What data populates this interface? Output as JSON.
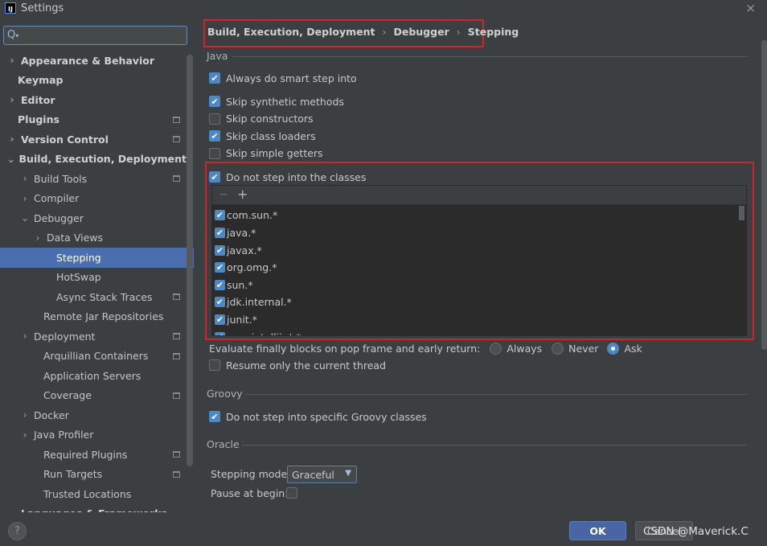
{
  "window": {
    "title": "Settings",
    "app_icon_text": "IJ",
    "close_glyph": "×"
  },
  "search": {
    "value": "",
    "icon": "search-icon"
  },
  "sidebar": {
    "items": [
      {
        "label": "Appearance & Behavior",
        "arrow": "›",
        "bold": true
      },
      {
        "label": "Keymap",
        "arrow": "",
        "bold": true
      },
      {
        "label": "Editor",
        "arrow": "›",
        "bold": true
      },
      {
        "label": "Plugins",
        "arrow": "",
        "bold": true
      },
      {
        "label": "Version Control",
        "arrow": "›",
        "bold": true
      },
      {
        "label": "Build, Execution, Deployment",
        "arrow": "⌄",
        "bold": true
      },
      {
        "label": "Build Tools",
        "arrow": "›"
      },
      {
        "label": "Compiler",
        "arrow": "›"
      },
      {
        "label": "Debugger",
        "arrow": "⌄"
      },
      {
        "label": "Data Views",
        "arrow": "›"
      },
      {
        "label": "Stepping",
        "arrow": ""
      },
      {
        "label": "HotSwap",
        "arrow": ""
      },
      {
        "label": "Async Stack Traces",
        "arrow": ""
      },
      {
        "label": "Remote Jar Repositories",
        "arrow": ""
      },
      {
        "label": "Deployment",
        "arrow": "›"
      },
      {
        "label": "Arquillian Containers",
        "arrow": ""
      },
      {
        "label": "Application Servers",
        "arrow": ""
      },
      {
        "label": "Coverage",
        "arrow": ""
      },
      {
        "label": "Docker",
        "arrow": "›"
      },
      {
        "label": "Java Profiler",
        "arrow": "›"
      },
      {
        "label": "Required Plugins",
        "arrow": ""
      },
      {
        "label": "Run Targets",
        "arrow": ""
      },
      {
        "label": "Trusted Locations",
        "arrow": ""
      },
      {
        "label": "Languages & Frameworks",
        "arrow": "›",
        "bold": true
      }
    ]
  },
  "breadcrumb": {
    "parts": [
      "Build, Execution, Deployment",
      "Debugger",
      "Stepping"
    ],
    "separator": "›"
  },
  "java": {
    "title": "Java",
    "smart_step_into": {
      "label": "Always do smart step into",
      "checked": true
    },
    "skip_synthetic": {
      "label": "Skip synthetic methods",
      "checked": true
    },
    "skip_constructors": {
      "label": "Skip constructors",
      "checked": false
    },
    "skip_class_loaders": {
      "label": "Skip class loaders",
      "checked": true
    },
    "skip_simple_getters": {
      "label": "Skip simple getters",
      "checked": false
    },
    "do_not_step_classes": {
      "label": "Do not step into the classes",
      "checked": true
    },
    "toolbar": {
      "remove": "−",
      "add": "+"
    },
    "class_filters": [
      "com.sun.*",
      "java.*",
      "javax.*",
      "org.omg.*",
      "sun.*",
      "jdk.internal.*",
      "junit.*",
      "com.intellij.rt.*"
    ],
    "evaluate_finally": {
      "label": "Evaluate finally blocks on pop frame and early return:",
      "options": [
        "Always",
        "Never",
        "Ask"
      ],
      "selected": "Ask"
    },
    "resume_current_thread": {
      "label": "Resume only the current thread",
      "checked": false
    }
  },
  "groovy": {
    "title": "Groovy",
    "do_not_step_groovy": {
      "label": "Do not step into specific Groovy classes",
      "checked": true
    }
  },
  "oracle": {
    "title": "Oracle",
    "stepping_mode_label": "Stepping mode:",
    "stepping_mode_value": "Graceful",
    "pause_at_begin_label": "Pause at begin:",
    "pause_at_begin_checked": false
  },
  "buttons": {
    "help": "?",
    "ok": "OK",
    "cancel": "Cancel"
  },
  "watermark": "CSDN @Maverick.C",
  "colors": {
    "accent": "#4b6eaf",
    "checkbox": "#4a88c7",
    "highlight_box": "#d0242a",
    "background": "#3c3f41"
  }
}
